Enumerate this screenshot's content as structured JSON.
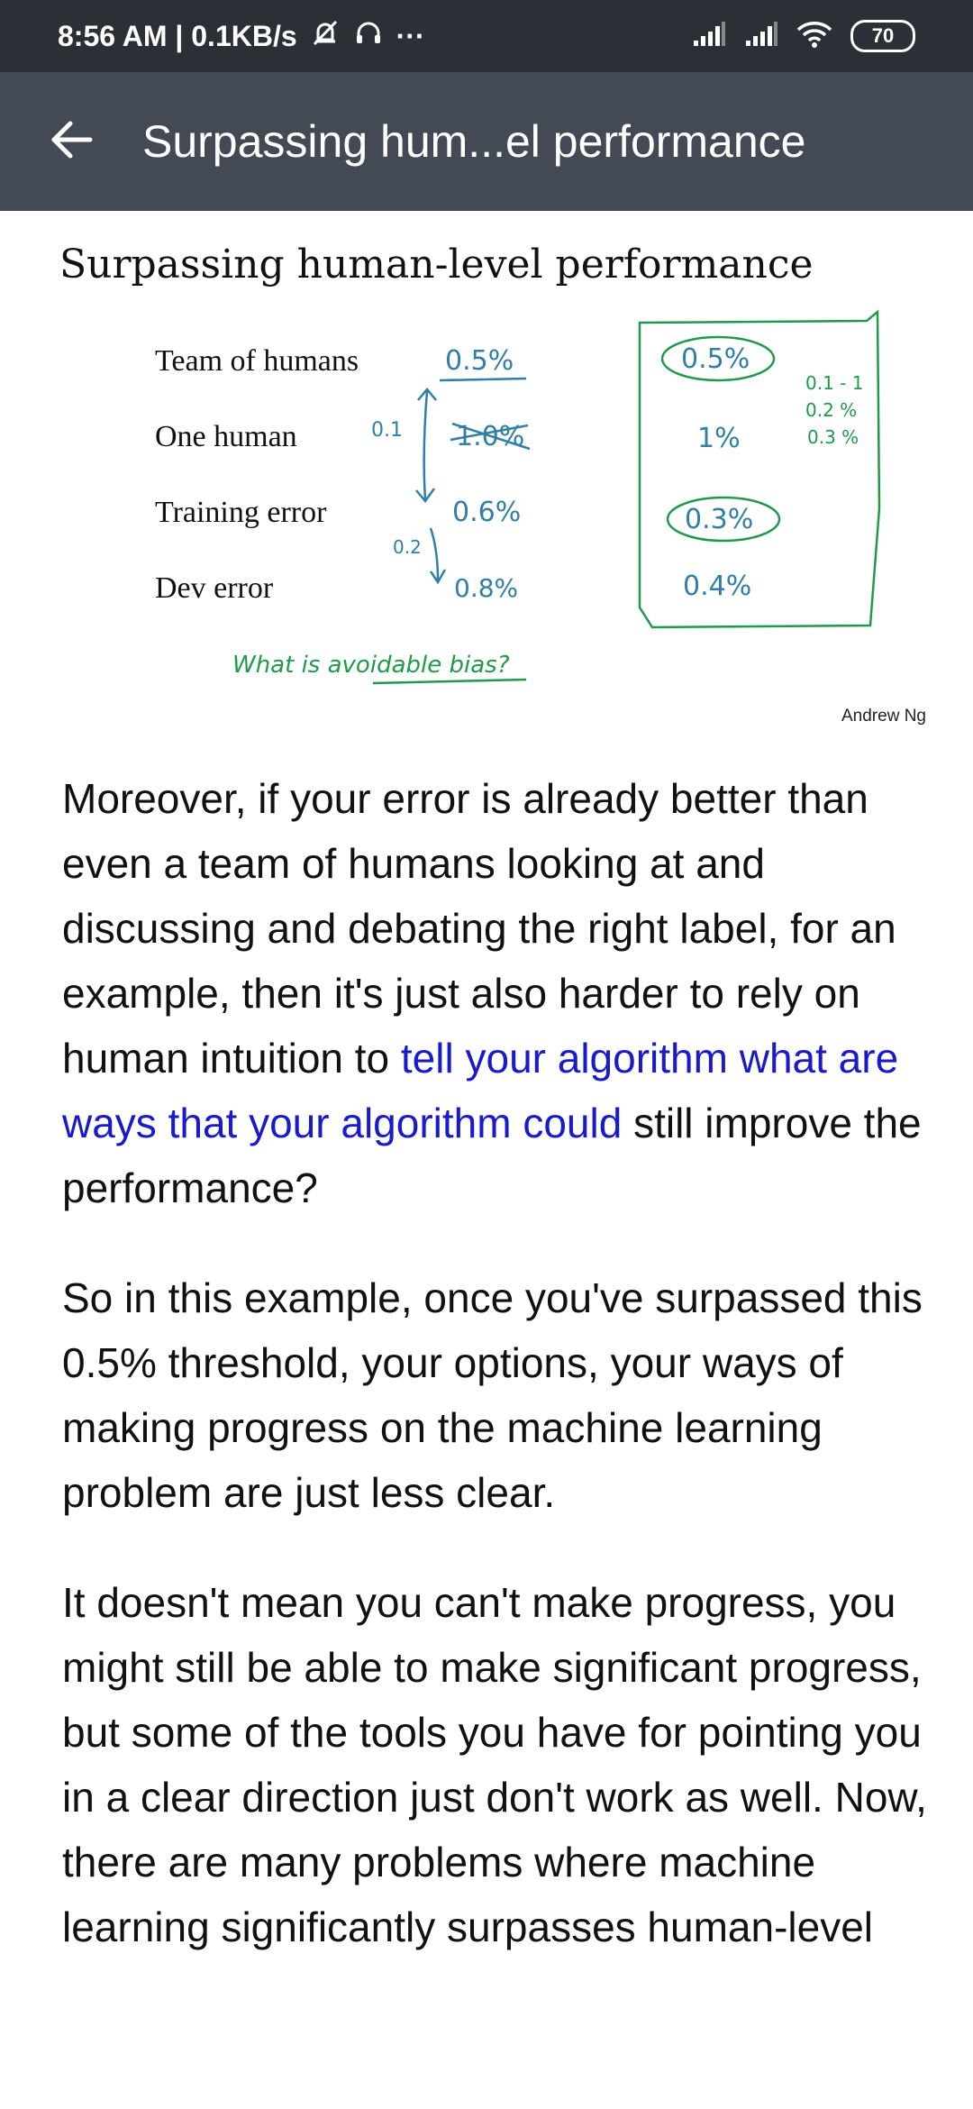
{
  "status_bar": {
    "time_speed": "8:56 AM | 0.1KB/s",
    "more": "···",
    "battery": "70"
  },
  "app_bar": {
    "title": "Surpassing hum...el performance"
  },
  "slide": {
    "title": "Surpassing human-level performance",
    "rows": [
      {
        "label": "Team of humans",
        "scenario_a": "0.5%",
        "scenario_b": "0.5%"
      },
      {
        "label": "One human",
        "scenario_a": "1.0%",
        "scenario_b": "1%"
      },
      {
        "label": "Training error",
        "scenario_a": "0.6%",
        "scenario_b": "0.3%"
      },
      {
        "label": "Dev error",
        "scenario_a": "0.8%",
        "scenario_b": "0.4%"
      }
    ],
    "annot_gap_top": "0.1",
    "annot_gap_bottom": "0.2",
    "annot_side": [
      "0.1 - 1",
      "0.2 %",
      "0.3 %"
    ],
    "question": "What is avoidable bias?",
    "credit": "Andrew Ng",
    "ink_blue": "#2f7fa6",
    "ink_green": "#1f9a4a"
  },
  "transcript": {
    "p1_before": "Moreover, if your error is already better than even a team of humans looking at and discussing and debating the right label, for an example, then it's just also harder to rely on human intuition to ",
    "p1_highlight": "tell your algorithm what are ways that your algorithm could",
    "p1_after": " still improve the performance?",
    "p2": "So in this example, once you've surpassed this 0.5% threshold, your options, your ways of making progress on the machine learning problem are just less clear.",
    "p3": "It doesn't mean you can't make progress, you might still be able to make significant progress, but some of the tools you have for pointing you in a clear direction just don't work as well. Now, there are many problems where machine learning significantly surpasses human-level"
  }
}
